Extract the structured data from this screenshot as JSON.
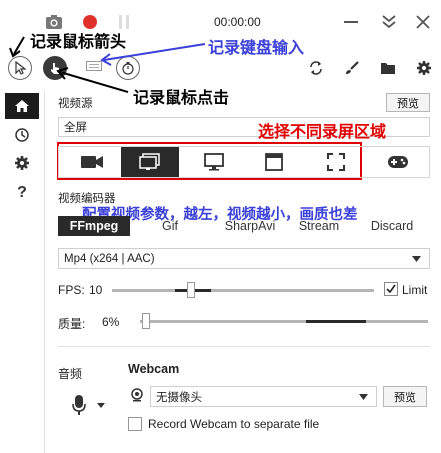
{
  "toolbar": {
    "timer": "00:00:00",
    "timer_icon": "stopwatch-icon",
    "keyboard_icon": "keyboard-icon"
  },
  "annotations": {
    "arrow_label": "记录鼠标箭头",
    "keyboard_label": "记录键盘输入",
    "click_label": "记录鼠标点击",
    "region_label": "选择不同录屏区域",
    "codec_label": "配置视频参数，越左，视频越小，画质也差"
  },
  "sidebar": {
    "items": [
      {
        "icon": "home-icon"
      },
      {
        "icon": "history-icon"
      },
      {
        "icon": "gear-icon"
      },
      {
        "icon": "help-icon",
        "label": "?"
      }
    ]
  },
  "video_source": {
    "label": "视频源",
    "preview": "预览",
    "value": "全屏",
    "options": [
      {
        "icon": "camera-icon"
      },
      {
        "icon": "screen-icon"
      },
      {
        "icon": "monitor-icon"
      },
      {
        "icon": "window-icon"
      },
      {
        "icon": "region-icon"
      },
      {
        "icon": "gamepad-icon"
      }
    ]
  },
  "video_encoder": {
    "label": "视频编码器",
    "tabs": [
      "FFmpeg",
      "Gif",
      "SharpAvi",
      "Stream",
      "Discard"
    ],
    "format": "Mp4 (x264 | AAC)"
  },
  "fps": {
    "label": "FPS:",
    "value": "10",
    "limit_label": "Limit",
    "limit_checked": true
  },
  "quality": {
    "label": "质量:",
    "value": "6%"
  },
  "audio": {
    "label": "音频"
  },
  "webcam": {
    "label": "Webcam",
    "value": "无摄像头",
    "preview": "预览",
    "separate_label": "Record Webcam to separate file"
  },
  "colors": {
    "annotation_black": "#000000",
    "annotation_blue": "#3a40d8",
    "annotation_red": "#e00000",
    "record_red": "#e0302a"
  }
}
